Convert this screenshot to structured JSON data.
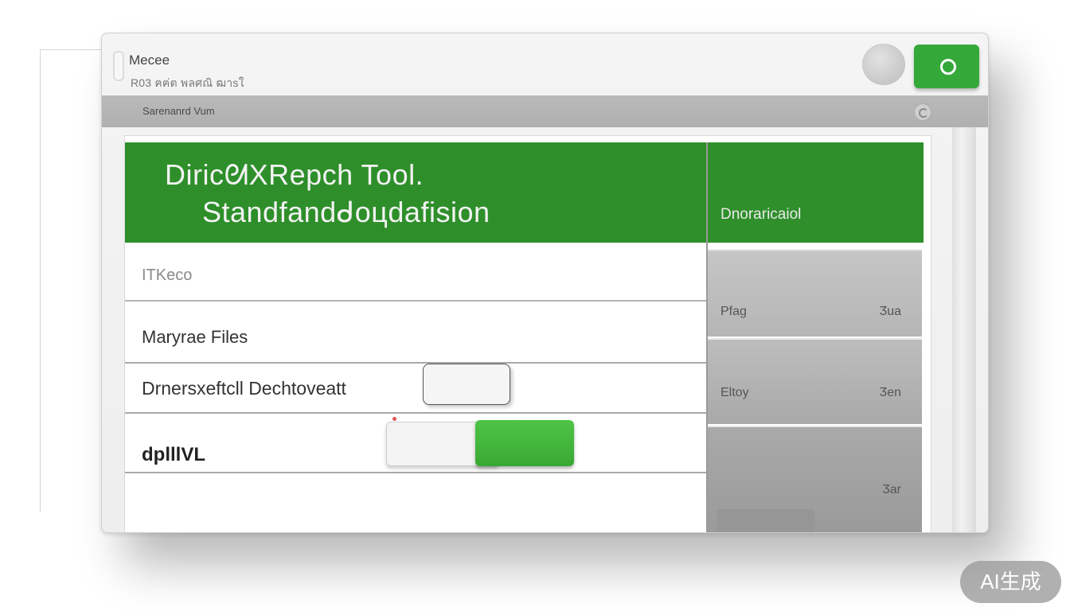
{
  "window": {
    "app_name": "Mecee",
    "app_subtitle": "R03 ฅฅ่ต  พลศณิ ฒาsใ",
    "toolbar_label": "Sarenanrd Vum"
  },
  "banner": {
    "title": "DiricᘛXRepch Tool.",
    "subtitle": "Standfandᑯoцdafision"
  },
  "rows": [
    {
      "label": "ITKeco"
    },
    {
      "label": "Maryrae Files"
    },
    {
      "label": "Drnersxeftcll Dechtoveatt",
      "toggle_state": "off"
    },
    {
      "label": "dplllVL",
      "toggle_state": "on"
    }
  ],
  "side_panel": {
    "header": "Dnoraricaiol",
    "cards": [
      {
        "key": "Pfag",
        "value": "Ӡua"
      },
      {
        "key": "Eltoy",
        "value": "Ӡen"
      },
      {
        "key": "",
        "value": "Ӡar"
      }
    ]
  },
  "watermark": "AI生成",
  "colors": {
    "accent_green": "#2e8f2a",
    "toggle_green": "#3fb638",
    "toolbar_gray": "#b5b5b5"
  }
}
